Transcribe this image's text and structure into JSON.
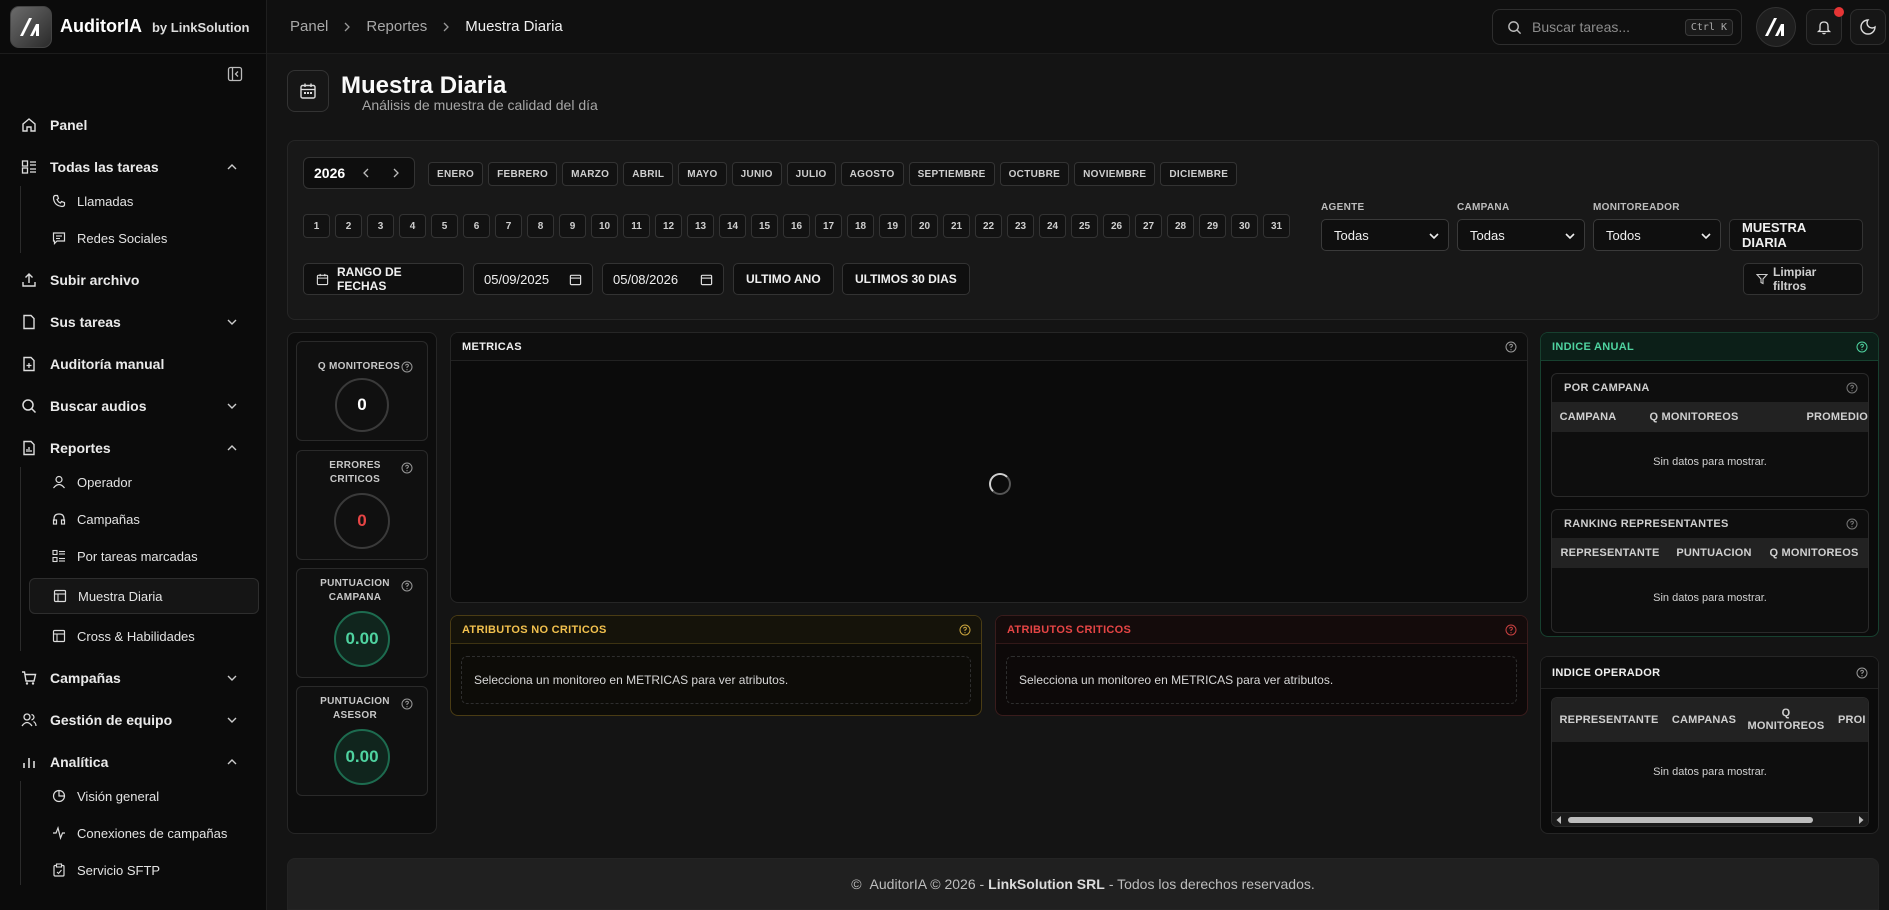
{
  "brand": {
    "name": "AuditorIA",
    "by": "by LinkSolution"
  },
  "nav": {
    "panel": "Panel",
    "todas_tareas": "Todas las tareas",
    "llamadas": "Llamadas",
    "redes": "Redes Sociales",
    "subir": "Subir archivo",
    "sus_tareas": "Sus tareas",
    "auditoria": "Auditoría manual",
    "buscar_audios": "Buscar audios",
    "reportes": "Reportes",
    "operador": "Operador",
    "campanas_sub": "Campañas",
    "por_tareas": "Por tareas marcadas",
    "muestra": "Muestra Diaria",
    "cross": "Cross & Habilidades",
    "campanas": "Campañas",
    "gestion": "Gestión de equipo",
    "analitica": "Analítica",
    "vision": "Visión general",
    "conexiones": "Conexiones de campañas",
    "sftp": "Servicio SFTP"
  },
  "breadcrumb": {
    "b1": "Panel",
    "b2": "Reportes",
    "b3": "Muestra Diaria"
  },
  "search": {
    "placeholder": "Buscar tareas...",
    "kbd": "Ctrl K"
  },
  "page": {
    "title": "Muestra Diaria",
    "subtitle": "Análisis de muestra de calidad del día"
  },
  "filters": {
    "year": "2026",
    "months": [
      "ENERO",
      "FEBRERO",
      "MARZO",
      "ABRIL",
      "MAYO",
      "JUNIO",
      "JULIO",
      "AGOSTO",
      "SEPTIEMBRE",
      "OCTUBRE",
      "NOVIEMBRE",
      "DICIEMBRE"
    ],
    "days": [
      "1",
      "2",
      "3",
      "4",
      "5",
      "6",
      "7",
      "8",
      "9",
      "10",
      "11",
      "12",
      "13",
      "14",
      "15",
      "16",
      "17",
      "18",
      "19",
      "20",
      "21",
      "22",
      "23",
      "24",
      "25",
      "26",
      "27",
      "28",
      "29",
      "30",
      "31"
    ],
    "agente_label": "AGENTE",
    "agente_value": "Todas",
    "campana_label": "CAMPANA",
    "campana_value": "Todas",
    "monitoreador_label": "MONITOREADOR",
    "monitoreador_value": "Todos",
    "muestra_btn": "MUESTRA DIARIA",
    "rango_btn": "RANGO DE FECHAS",
    "date_from": "05/09/2025",
    "date_to": "05/08/2026",
    "ultimo_ano": "ULTIMO ANO",
    "ultimos_30": "ULTIMOS 30 DIAS",
    "limpiar": "Limpiar filtros"
  },
  "kpis": {
    "q_label": "Q MONITOREOS",
    "q_value": "0",
    "err_label1": "ERRORES",
    "err_label2": "CRITICOS",
    "err_value": "0",
    "pc_label1": "PUNTUACION",
    "pc_label2": "CAMPANA",
    "pc_value": "0.00",
    "pa_label1": "PUNTUACION",
    "pa_label2": "ASESOR",
    "pa_value": "0.00"
  },
  "metricas": {
    "title": "METRICAS"
  },
  "attr_nc": {
    "title": "ATRIBUTOS NO CRITICOS",
    "msg": "Selecciona un monitoreo en METRICAS para ver atributos."
  },
  "attr_c": {
    "title": "ATRIBUTOS CRITICOS",
    "msg": "Selecciona un monitoreo en METRICAS para ver atributos."
  },
  "indice_anual": {
    "title": "INDICE ANUAL",
    "por_campana": {
      "title": "POR CAMPANA",
      "cols": [
        "CAMPANA",
        "Q MONITOREOS",
        "PROMEDIO"
      ],
      "empty": "Sin datos para mostrar."
    },
    "ranking": {
      "title": "RANKING REPRESENTANTES",
      "cols": [
        "REPRESENTANTE",
        "PUNTUACION",
        "Q MONITOREOS"
      ],
      "empty": "Sin datos para mostrar."
    }
  },
  "indice_operador": {
    "title": "INDICE OPERADOR",
    "cols": [
      "REPRESENTANTE",
      "CAMPANAS",
      "Q MONITOREOS",
      "PROI"
    ],
    "col3a": "Q",
    "col3b": "MONITOREOS",
    "empty": "Sin datos para mostrar."
  },
  "footer": {
    "pre": "AuditorIA © 2026 -",
    "company": "LinkSolution SRL",
    "post": "- Todos los derechos reservados.",
    "copy": "©"
  },
  "colors": {
    "accent_green": "#4fd3a0",
    "accent_yellow": "#f2c14e",
    "accent_red": "#e64545",
    "notif": "#e63535"
  }
}
